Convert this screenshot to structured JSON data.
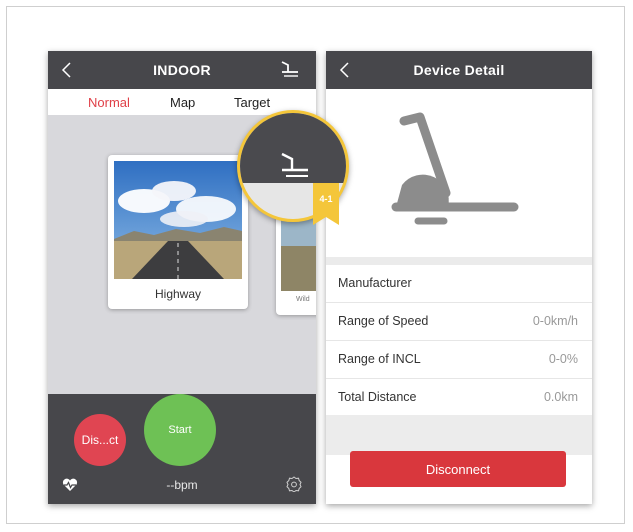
{
  "left_screen": {
    "title": "INDOOR",
    "tabs": [
      {
        "label": "Normal",
        "active": true
      },
      {
        "label": "Map",
        "active": false
      },
      {
        "label": "Target",
        "active": false
      }
    ],
    "cards": [
      {
        "label": "Highway"
      },
      {
        "label": "Wild"
      }
    ],
    "buttons": {
      "disconnect_short": "Dis...ct",
      "start": "Start"
    },
    "heart_rate": "--bpm"
  },
  "right_screen": {
    "title": "Device Detail",
    "specs": [
      {
        "label": "Manufacturer",
        "value": ""
      },
      {
        "label": "Range of Speed",
        "value": "0-0km/h"
      },
      {
        "label": "Range of INCL",
        "value": "0-0%"
      },
      {
        "label": "Total Distance",
        "value": "0.0km"
      }
    ],
    "disconnect_label": "Disconnect"
  },
  "callout": {
    "badge": "4-1"
  },
  "colors": {
    "nav_bg": "#47474b",
    "accent_red": "#e04048",
    "start_green": "#6ec155",
    "disconnect_red": "#d9373d",
    "callout_yellow": "#f4c63a"
  }
}
